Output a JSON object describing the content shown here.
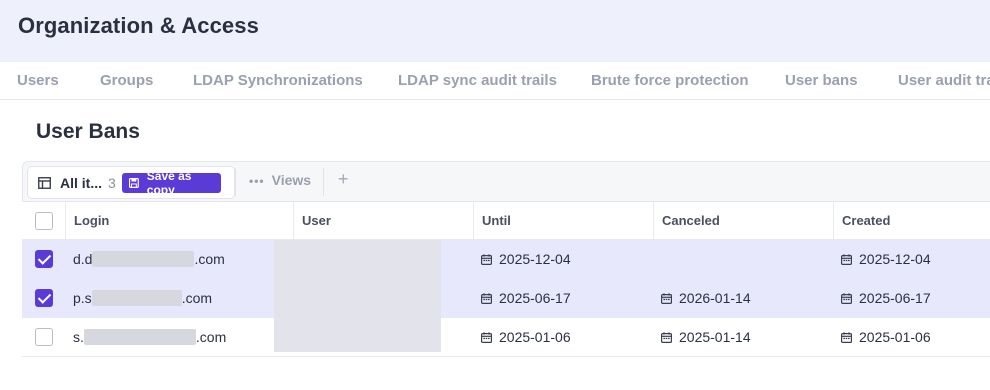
{
  "header": {
    "title": "Organization & Access"
  },
  "tabs": [
    {
      "label": "Users"
    },
    {
      "label": "Groups"
    },
    {
      "label": "LDAP Synchronizations"
    },
    {
      "label": "LDAP sync audit trails"
    },
    {
      "label": "Brute force protection"
    },
    {
      "label": "User bans"
    },
    {
      "label": "User audit tra"
    }
  ],
  "page": {
    "title": "User Bans"
  },
  "toolbar": {
    "view_name": "All it...",
    "view_count": "3",
    "save_copy_label": "Save as copy",
    "views_label": "Views",
    "add_label": "+"
  },
  "table": {
    "columns": [
      "Login",
      "User",
      "Until",
      "Canceled",
      "Created"
    ],
    "rows": [
      {
        "selected": true,
        "login_prefix": "d.d",
        "login_suffix": ".com",
        "until": "2025-12-04",
        "canceled": "",
        "created": "2025-12-04"
      },
      {
        "selected": true,
        "login_prefix": "p.s",
        "login_suffix": ".com",
        "until": "2025-06-17",
        "canceled": "2026-01-14",
        "created": "2025-06-17"
      },
      {
        "selected": false,
        "login_prefix": "s.",
        "login_suffix": ".com",
        "until": "2025-01-06",
        "canceled": "2025-01-14",
        "created": "2025-01-06"
      }
    ]
  },
  "colors": {
    "accent": "#5b3bd6",
    "header_bg": "#eef0fc",
    "selected_row": "#e7e8fb"
  },
  "icons": {
    "view": "table-icon",
    "save": "floppy-disk-icon",
    "date": "calendar-icon",
    "views": "ellipsis-icon",
    "add": "plus-icon"
  }
}
